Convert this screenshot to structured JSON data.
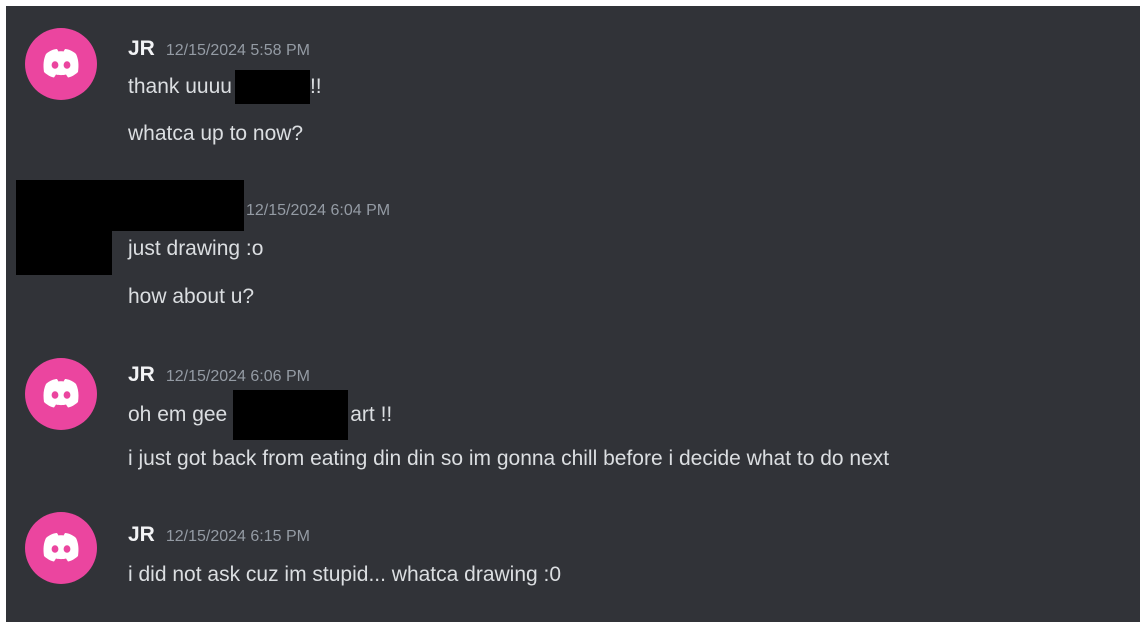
{
  "messages": [
    {
      "author": "JR",
      "timestamp": "12/15/2024 5:58 PM",
      "avatar_color": "#eb459f",
      "avatar_icon": "discord-logo-icon",
      "lines": [
        {
          "before": "thank uuuu",
          "after": "!!"
        },
        {
          "text": "whatca up to now?"
        }
      ]
    },
    {
      "author": "",
      "author_redacted": true,
      "timestamp": "12/15/2024 6:04 PM",
      "lines": [
        {
          "text": "just drawing :o"
        },
        {
          "text": "how about u?"
        }
      ]
    },
    {
      "author": "JR",
      "timestamp": "12/15/2024 6:06 PM",
      "avatar_color": "#eb459f",
      "avatar_icon": "discord-logo-icon",
      "lines": [
        {
          "before": "oh em gee",
          "after": "art !!"
        },
        {
          "text": "i just got back from eating din din so im gonna chill before i decide what to do next"
        }
      ]
    },
    {
      "author": "JR",
      "timestamp": "12/15/2024 6:15 PM",
      "avatar_color": "#eb459f",
      "avatar_icon": "discord-logo-icon",
      "lines": [
        {
          "text": "i did not ask cuz im stupid... whatca drawing :0"
        }
      ]
    }
  ],
  "colors": {
    "background": "#313338",
    "author": "#f2f3f5",
    "timestamp": "#949ba4",
    "message_text": "#dbdee1",
    "redaction": "#000000"
  }
}
